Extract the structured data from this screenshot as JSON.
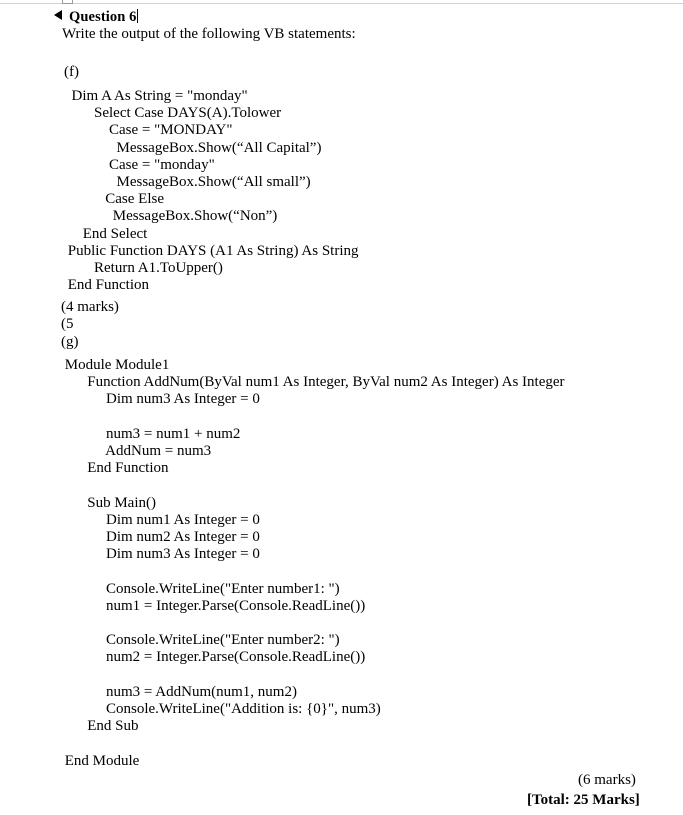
{
  "document": {
    "heading": "Question 6",
    "intro": "Write the output of the following VB statements:"
  },
  "sections": [
    {
      "label": "(f)",
      "code": [
        "  Dim A As String = \"monday\"",
        "        Select Case DAYS(A).Tolower",
        "            Case = \"MONDAY\"",
        "              MessageBox.Show(“All Capital”)",
        "            Case = \"monday\"",
        "              MessageBox.Show(“All small”)",
        "           Case Else",
        "             MessageBox.Show(“Non”)",
        "     End Select",
        " Public Function DAYS (A1 As String) As String",
        "        Return A1.ToUpper()",
        " End Function"
      ],
      "marks": "(4 marks)",
      "orphan": "(5"
    },
    {
      "label": "(g)",
      "code": [
        " Module Module1",
        "       Function AddNum(ByVal num1 As Integer, ByVal num2 As Integer) As Integer",
        "            Dim num3 As Integer = 0",
        "",
        "            num3 = num1 + num2",
        "            AddNum = num3",
        "       End Function",
        "",
        "       Sub Main()",
        "            Dim num1 As Integer = 0",
        "            Dim num2 As Integer = 0",
        "            Dim num3 As Integer = 0",
        "",
        "            Console.WriteLine(\"Enter number1: \")",
        "            num1 = Integer.Parse(Console.ReadLine())",
        "",
        "            Console.WriteLine(\"Enter number2: \")",
        "            num2 = Integer.Parse(Console.ReadLine())",
        "",
        "            num3 = AddNum(num1, num2)",
        "            Console.WriteLine(\"Addition is: {0}\", num3)",
        "       End Sub",
        "",
        " End Module"
      ],
      "marks": "(6 marks)"
    }
  ],
  "footer": {
    "total": "[Total: 25 Marks]"
  }
}
